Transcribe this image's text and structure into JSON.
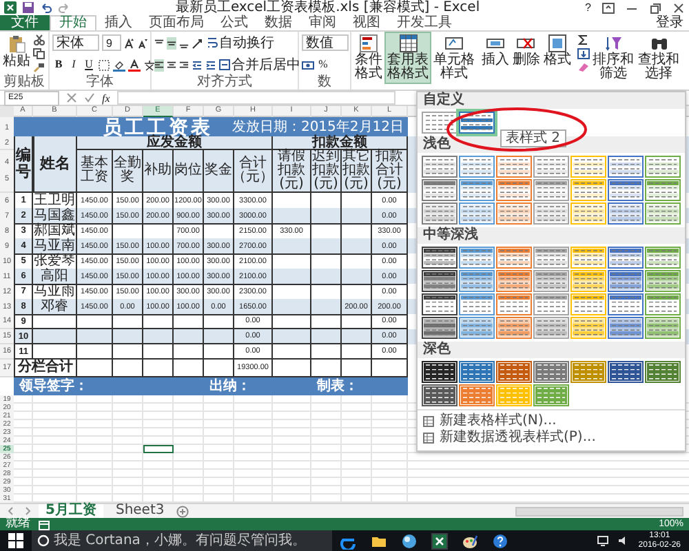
{
  "window": {
    "title": "最新员工excel工资表模板.xls  [兼容模式] - Excel",
    "help": "?"
  },
  "ribbon_tabs": [
    {
      "label": "文件",
      "kind": "file",
      "selected": false
    },
    {
      "label": "开始",
      "kind": "tab",
      "selected": true
    },
    {
      "label": "插入",
      "kind": "tab",
      "selected": false
    },
    {
      "label": "页面布局",
      "kind": "tab",
      "selected": false
    },
    {
      "label": "公式",
      "kind": "tab",
      "selected": false
    },
    {
      "label": "数据",
      "kind": "tab",
      "selected": false
    },
    {
      "label": "审阅",
      "kind": "tab",
      "selected": false
    },
    {
      "label": "视图",
      "kind": "tab",
      "selected": false
    },
    {
      "label": "开发工具",
      "kind": "tab",
      "selected": false
    }
  ],
  "sign_in": "登录",
  "ribbon": {
    "clipboard": {
      "paste": "粘贴",
      "label": "剪贴板"
    },
    "font": {
      "name": "宋体",
      "size": "9",
      "bold": "B",
      "italic": "I",
      "underline": "U",
      "label": "字体"
    },
    "alignment": {
      "wrap": "自动换行",
      "merge": "合并后居中",
      "label": "对齐方式"
    },
    "number": {
      "format": "数值",
      "percent": "%",
      "label": "数"
    },
    "styles": {
      "conditional": "条件格式",
      "table": "套用表格格式",
      "table_pressed": true,
      "cell": "单元格样式"
    },
    "cells": {
      "insert": "插入",
      "delete": "删除",
      "format": "格式"
    },
    "editing": {
      "sort": "排序和筛选",
      "find": "查找和选择"
    }
  },
  "formula_bar": {
    "name_box": "E25",
    "fx": "fx"
  },
  "sheet": {
    "columns": [
      {
        "label": "A",
        "selected": false
      },
      {
        "label": "B",
        "selected": false
      },
      {
        "label": "C",
        "selected": false
      },
      {
        "label": "D",
        "selected": false
      },
      {
        "label": "E",
        "selected": true
      },
      {
        "label": "F",
        "selected": false
      },
      {
        "label": "G",
        "selected": false
      },
      {
        "label": "H",
        "selected": false
      },
      {
        "label": "I",
        "selected": false
      },
      {
        "label": "J",
        "selected": false
      },
      {
        "label": "K",
        "selected": false
      },
      {
        "label": "L",
        "selected": false
      }
    ],
    "title_row": "1",
    "title": "员工工资表",
    "date": "发放日期：2015年2月12日",
    "header_rows": [
      "2",
      "4",
      "5"
    ],
    "header": {
      "number": "编号",
      "name": "姓名",
      "pay_group": "应发金额",
      "pay_columns": [
        "基本工资",
        "全勤奖",
        "补助",
        "岗位",
        "奖金",
        "合计（元）"
      ],
      "deduct_group": "扣款金额",
      "deduct_columns": [
        "请假扣款(元)",
        "迟到扣款(元)",
        "其它扣款(元)",
        "扣款合计(元)"
      ]
    },
    "rows": [
      {
        "row": "6",
        "cells": [
          "1",
          "王卫明",
          "1450.00",
          "150.00",
          "200.00",
          "1200.00",
          "300.00",
          "3300.00",
          "",
          "",
          "",
          "0.00"
        ]
      },
      {
        "row": "7",
        "cells": [
          "2",
          "马国鑫",
          "1450.00",
          "150.00",
          "200.00",
          "900.00",
          "300.00",
          "3000.00",
          "",
          "",
          "",
          "0.00"
        ]
      },
      {
        "row": "8",
        "cells": [
          "3",
          "郝国斌",
          "1450.00",
          "",
          "",
          "700.00",
          "",
          "2150.00",
          "330.00",
          "",
          "",
          "330.00"
        ]
      },
      {
        "row": "9",
        "cells": [
          "4",
          "马亚南",
          "1450.00",
          "150.00",
          "100.00",
          "700.00",
          "300.00",
          "2700.00",
          "",
          "",
          "",
          "0.00"
        ]
      },
      {
        "row": "10",
        "cells": [
          "5",
          "张爱琴",
          "1450.00",
          "150.00",
          "100.00",
          "100.00",
          "300.00",
          "2100.00",
          "",
          "",
          "",
          "0.00"
        ]
      },
      {
        "row": "11",
        "cells": [
          "6",
          "高阳",
          "1450.00",
          "150.00",
          "100.00",
          "100.00",
          "300.00",
          "2100.00",
          "",
          "",
          "",
          "0.00"
        ]
      },
      {
        "row": "12",
        "cells": [
          "7",
          "马亚雨",
          "1450.00",
          "150.00",
          "100.00",
          "300.00",
          "300.00",
          "2300.00",
          "",
          "",
          "",
          "0.00"
        ]
      },
      {
        "row": "13",
        "cells": [
          "8",
          "邓睿",
          "1450.00",
          "0.00",
          "100.00",
          "100.00",
          "0.00",
          "1650.00",
          "",
          "",
          "200.00",
          "200.00"
        ]
      },
      {
        "row": "14",
        "cells": [
          "9",
          "",
          "",
          "",
          "",
          "",
          "",
          "0.00",
          "",
          "",
          "",
          "0.00"
        ]
      },
      {
        "row": "15",
        "cells": [
          "10",
          "",
          "",
          "",
          "",
          "",
          "",
          "0.00",
          "",
          "",
          "",
          "0.00"
        ]
      },
      {
        "row": "16",
        "cells": [
          "11",
          "",
          "",
          "",
          "",
          "",
          "",
          "0.00",
          "",
          "",
          "",
          "0.00"
        ]
      }
    ],
    "total": {
      "row": "17",
      "cells": [
        "分栏合计",
        "",
        "",
        "",
        "",
        "",
        "",
        "19300.00",
        "",
        "",
        "",
        ""
      ]
    },
    "footer": {
      "sign": "领导签字：",
      "cashier": "出纳：",
      "maker": "制表："
    },
    "empty_rows": [
      {
        "row": "19",
        "selected": false
      },
      {
        "row": "20",
        "selected": false
      },
      {
        "row": "21",
        "selected": false
      },
      {
        "row": "22",
        "selected": false
      },
      {
        "row": "23",
        "selected": false
      },
      {
        "row": "24",
        "selected": false
      },
      {
        "row": "25",
        "selected": true
      },
      {
        "row": "26",
        "selected": false
      },
      {
        "row": "27",
        "selected": false
      },
      {
        "row": "28",
        "selected": false
      },
      {
        "row": "29",
        "selected": false
      },
      {
        "row": "30",
        "selected": false
      },
      {
        "row": "31",
        "selected": false
      }
    ]
  },
  "gallery": {
    "sections": [
      {
        "title": "自定义",
        "kind": "custom",
        "swatches": [
          {
            "color": "#a6a6a6",
            "selected": false
          },
          {
            "color": "#2e75b6",
            "selected": true
          }
        ]
      },
      {
        "title": "浅色",
        "kind": "light",
        "swatches": [
          {
            "color": "#7f7f7f"
          },
          {
            "color": "#5b9bd5"
          },
          {
            "color": "#ed7d31"
          },
          {
            "color": "#a5a5a5"
          },
          {
            "color": "#ffc000"
          },
          {
            "color": "#4472c4"
          },
          {
            "color": "#70ad47"
          },
          {
            "color": "#7f7f7f"
          },
          {
            "color": "#5b9bd5"
          },
          {
            "color": "#ed7d31"
          },
          {
            "color": "#a5a5a5"
          },
          {
            "color": "#ffc000"
          },
          {
            "color": "#4472c4"
          },
          {
            "color": "#70ad47"
          },
          {
            "color": "#7f7f7f"
          },
          {
            "color": "#5b9bd5"
          },
          {
            "color": "#ed7d31"
          },
          {
            "color": "#a5a5a5"
          },
          {
            "color": "#ffc000"
          },
          {
            "color": "#4472c4"
          },
          {
            "color": "#70ad47"
          }
        ]
      },
      {
        "title": "中等深浅",
        "kind": "medium",
        "swatches": [
          {
            "color": "#404040"
          },
          {
            "color": "#5b9bd5"
          },
          {
            "color": "#ed7d31"
          },
          {
            "color": "#a5a5a5"
          },
          {
            "color": "#ffc000"
          },
          {
            "color": "#4472c4"
          },
          {
            "color": "#70ad47"
          },
          {
            "color": "#404040"
          },
          {
            "color": "#5b9bd5"
          },
          {
            "color": "#ed7d31"
          },
          {
            "color": "#a5a5a5"
          },
          {
            "color": "#ffc000"
          },
          {
            "color": "#4472c4"
          },
          {
            "color": "#70ad47"
          },
          {
            "color": "#404040"
          },
          {
            "color": "#5b9bd5"
          },
          {
            "color": "#ed7d31"
          },
          {
            "color": "#a5a5a5"
          },
          {
            "color": "#ffc000"
          },
          {
            "color": "#4472c4"
          },
          {
            "color": "#70ad47"
          },
          {
            "color": "#404040"
          },
          {
            "color": "#5b9bd5"
          },
          {
            "color": "#ed7d31"
          },
          {
            "color": "#a5a5a5"
          },
          {
            "color": "#ffc000"
          },
          {
            "color": "#4472c4"
          },
          {
            "color": "#70ad47"
          }
        ]
      },
      {
        "title": "深色",
        "kind": "dark",
        "swatches": [
          {
            "color": "#262626"
          },
          {
            "color": "#2e75b6"
          },
          {
            "color": "#c55a11"
          },
          {
            "color": "#7b7b7b"
          },
          {
            "color": "#bf9000"
          },
          {
            "color": "#2f5597"
          },
          {
            "color": "#548235"
          },
          {
            "color": "#595959"
          },
          {
            "color": "#ed7d31"
          },
          {
            "color": "#ffc000"
          },
          {
            "color": "#70ad47"
          }
        ]
      }
    ],
    "tooltip": "表样式 2",
    "menu": [
      "新建表格样式(N)...",
      "新建数据透视表样式(P)..."
    ]
  },
  "sheet_tabs": [
    {
      "label": "5月工资",
      "selected": true
    },
    {
      "label": "Sheet3",
      "selected": false
    }
  ],
  "status_bar": {
    "text": "就绪",
    "zoom": "100%"
  },
  "taskbar": {
    "search": {
      "placeholder": "我是 Cortana，小娜。有问题尽管问我。"
    },
    "time": "13:01",
    "date": "2016-02-26"
  }
}
